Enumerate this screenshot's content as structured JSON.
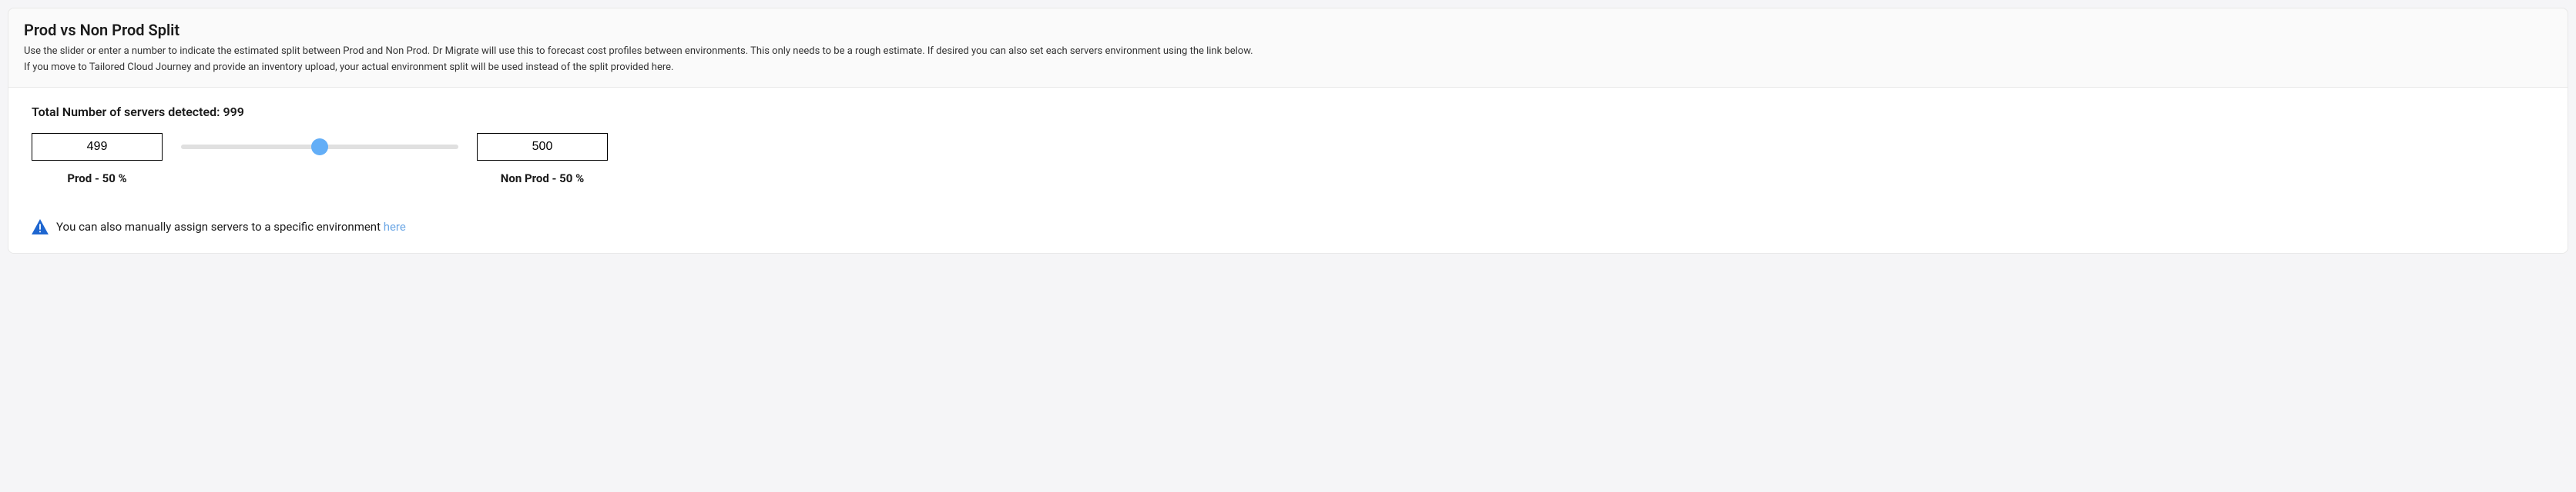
{
  "header": {
    "title": "Prod vs Non Prod Split",
    "description_line1": "Use the slider or enter a number to indicate the estimated split between Prod and Non Prod. Dr Migrate will use this to forecast cost profiles between environments. This only needs to be a rough estimate. If desired you can also set each servers environment using the link below.",
    "description_line2": "If you move to Tailored Cloud Journey and provide an inventory upload, your actual environment split will be used instead of the split provided here."
  },
  "body": {
    "total_label": "Total Number of servers detected: 999",
    "prod_value": "499",
    "nonprod_value": "500",
    "prod_label": "Prod - 50 %",
    "nonprod_label": "Non Prod - 50 %",
    "slider_percent": 50
  },
  "note": {
    "text": "You can also manually assign servers to a specific environment ",
    "link_text": "here"
  }
}
